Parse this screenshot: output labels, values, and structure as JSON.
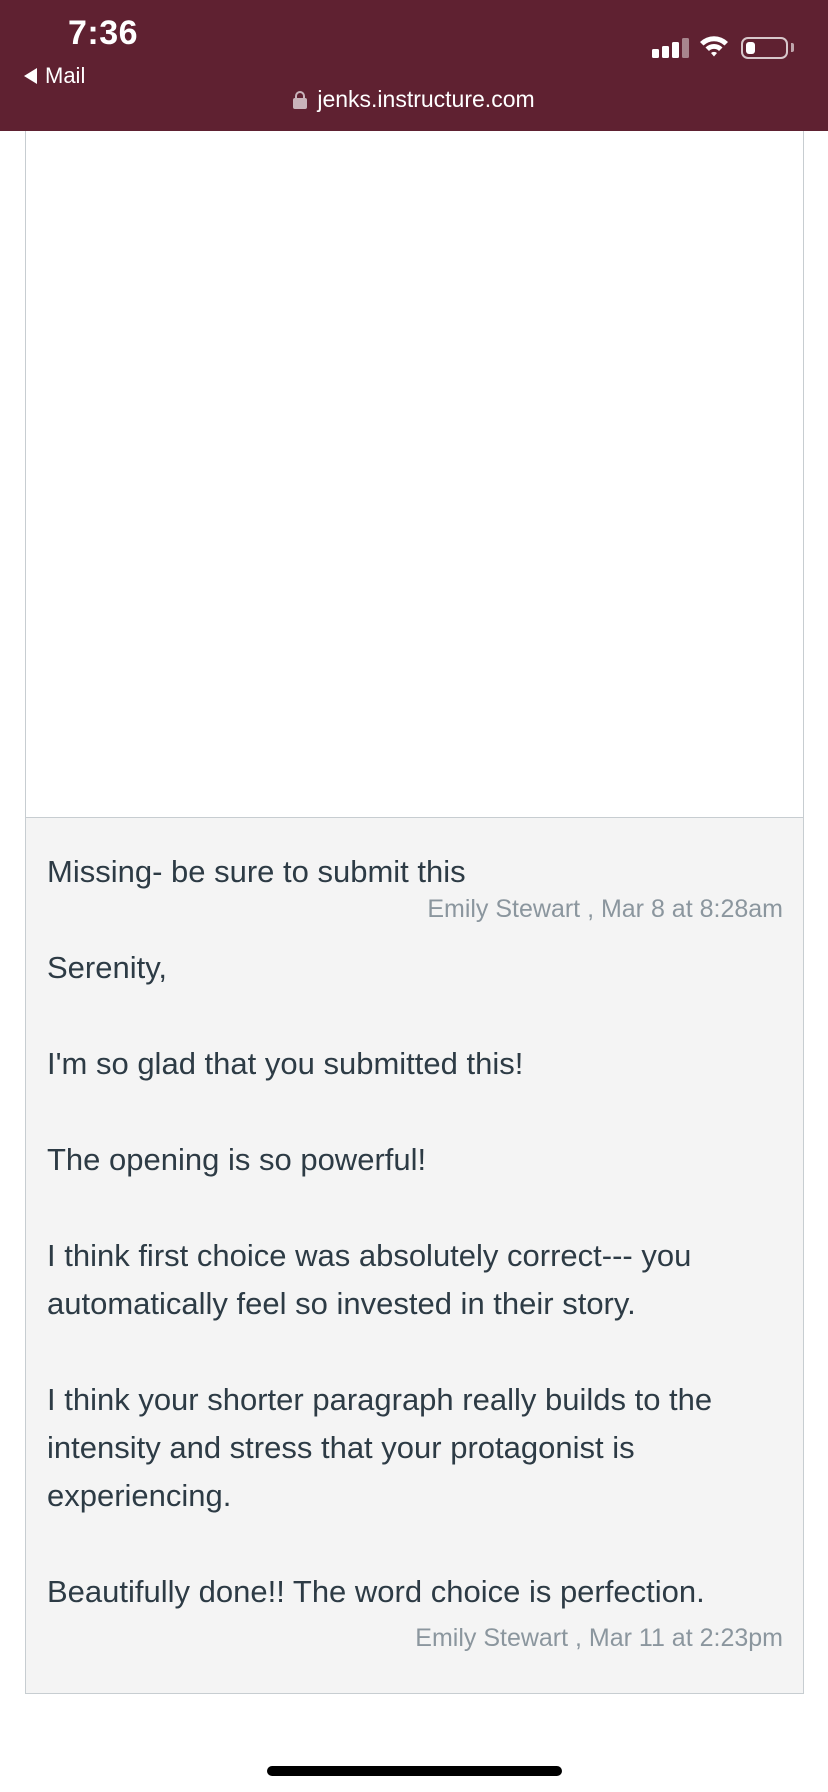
{
  "status_bar": {
    "time": "7:36",
    "back_label": "Mail",
    "url": "jenks.instructure.com",
    "battery_level": 0.25
  },
  "comments": [
    {
      "text": "Missing- be sure to submit this",
      "meta": "Emily Stewart , Mar 8 at 8:28am"
    },
    {
      "text": "Serenity,\n\nI'm so glad that you submitted this!\n\nThe opening is so powerful!\n\nI think first choice was absolutely correct--- you automatically feel so invested in their story.\n\nI think your shorter paragraph really builds to the intensity and stress that your protagonist is experiencing.\n\nBeautifully done!! The word choice is perfection.",
      "meta": "Emily Stewart , Mar 11 at 2:23pm"
    }
  ],
  "colors": {
    "status_bar_bg": "#5f2131",
    "comments_bg": "#f4f4f4",
    "text": "#2d3b45",
    "meta_text": "#8b969e"
  }
}
